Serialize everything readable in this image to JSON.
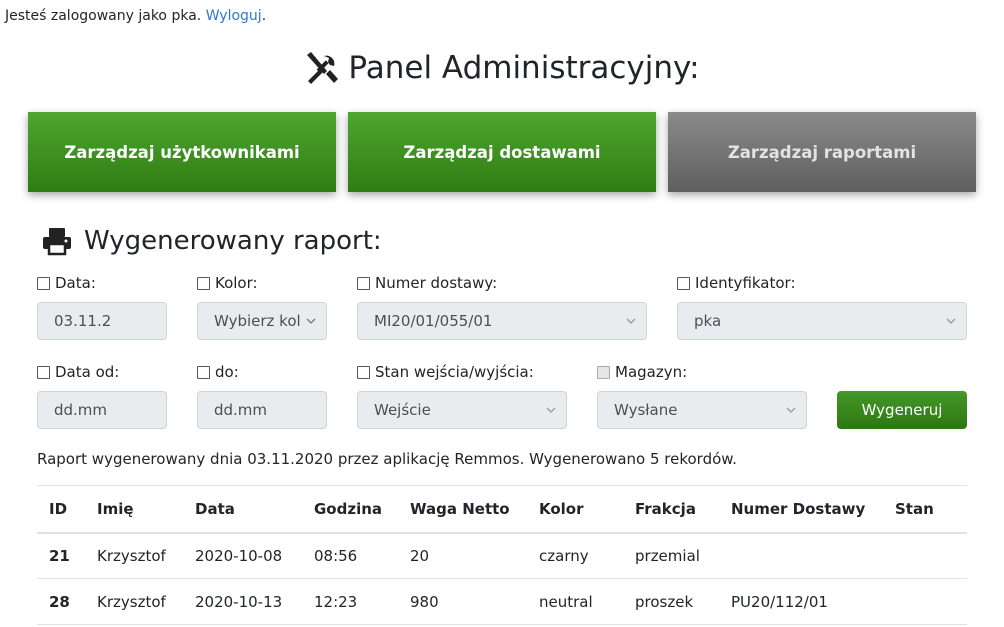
{
  "header": {
    "logged_text": "Jesteś zalogowany jako pka.",
    "logout_link": "Wyloguj",
    "logout_dot": "."
  },
  "page": {
    "title": "Panel Administracyjny:",
    "title_icon": "tools-icon"
  },
  "nav_buttons": [
    {
      "label": "Zarządzaj użytkownikami",
      "color": "#3f951f"
    },
    {
      "label": "Zarządzaj dostawami",
      "color": "#3f951f"
    },
    {
      "label": "Zarządzaj raportami",
      "color": "#747474"
    }
  ],
  "report": {
    "title": "Wygenerowany raport:",
    "title_icon": "printer-icon",
    "filters": {
      "date_label": "Data:",
      "date_value": "03.11.2",
      "color_label": "Kolor:",
      "color_value": "Wybierz kol",
      "delivery_label": "Numer dostawy:",
      "delivery_value": "MI20/01/055/01",
      "identifier_label": "Identyfikator:",
      "identifier_value": "pka",
      "date_from_label": "Data od:",
      "date_from_placeholder": "dd.mm",
      "date_to_label": "do:",
      "date_to_placeholder": "dd.mm",
      "state_label": "Stan wejścia/wyjścia:",
      "state_value": "Wejście",
      "warehouse_label": "Magazyn:",
      "warehouse_value": "Wysłane"
    },
    "generate_button": "Wygeneruj",
    "info": "Raport wygenerowany dnia 03.11.2020 przez aplikację Remmos. Wygenerowano 5 rekordów."
  },
  "table": {
    "columns": [
      "ID",
      "Imię",
      "Data",
      "Godzina",
      "Waga Netto",
      "Kolor",
      "Frakcja",
      "Numer Dostawy",
      "Stan"
    ],
    "rows": [
      [
        "21",
        "Krzysztof",
        "2020-10-08",
        "08:56",
        "20",
        "czarny",
        "przemial",
        "",
        ""
      ],
      [
        "28",
        "Krzysztof",
        "2020-10-13",
        "12:23",
        "980",
        "neutral",
        "proszek",
        "PU20/112/01",
        ""
      ]
    ]
  }
}
